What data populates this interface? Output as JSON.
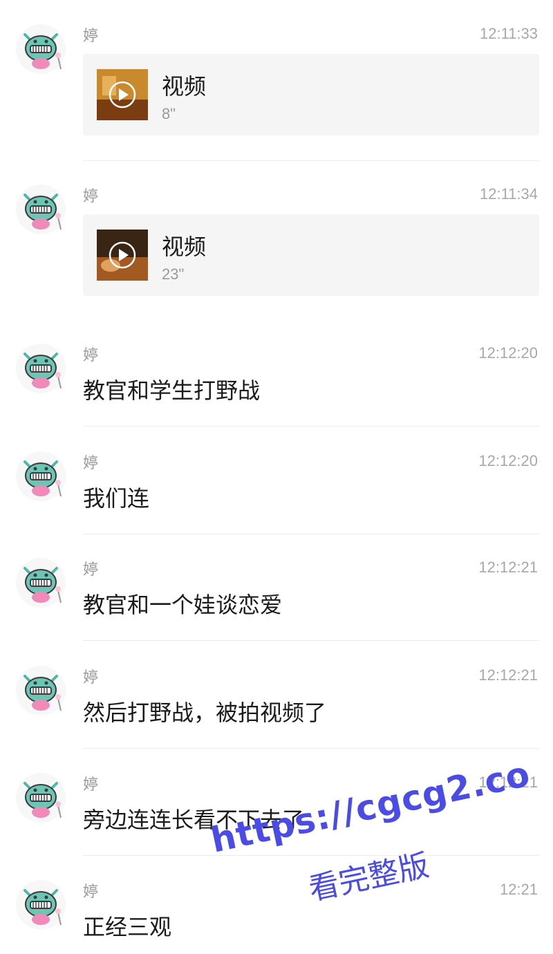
{
  "messages": [
    {
      "sender": "婷",
      "time": "12:11:33",
      "type": "video",
      "video_label": "视频",
      "duration": "8\""
    },
    {
      "sender": "婷",
      "time": "12:11:34",
      "type": "video",
      "video_label": "视频",
      "duration": "23\""
    },
    {
      "sender": "婷",
      "time": "12:12:20",
      "type": "text",
      "text": "教官和学生打野战"
    },
    {
      "sender": "婷",
      "time": "12:12:20",
      "type": "text",
      "text": "我们连"
    },
    {
      "sender": "婷",
      "time": "12:12:21",
      "type": "text",
      "text": "教官和一个娃谈恋爱"
    },
    {
      "sender": "婷",
      "time": "12:12:21",
      "type": "text",
      "text": "然后打野战，被拍视频了"
    },
    {
      "sender": "婷",
      "time": "12:12:21",
      "type": "text",
      "text": "旁边连连长看不下去了"
    },
    {
      "sender": "婷",
      "time": "12:21",
      "type": "text",
      "text": "正经三观"
    }
  ],
  "watermark": {
    "url": "https://cgcg2.co",
    "caption": "看完整版"
  },
  "icons": {
    "avatar": "cartoon-monster-avatar-icon",
    "play": "play-circle-icon"
  },
  "colors": {
    "text": "#1b1b1b",
    "meta": "#9a9a9a",
    "card_bg": "#f5f5f5",
    "watermark": "#4b4be6"
  }
}
